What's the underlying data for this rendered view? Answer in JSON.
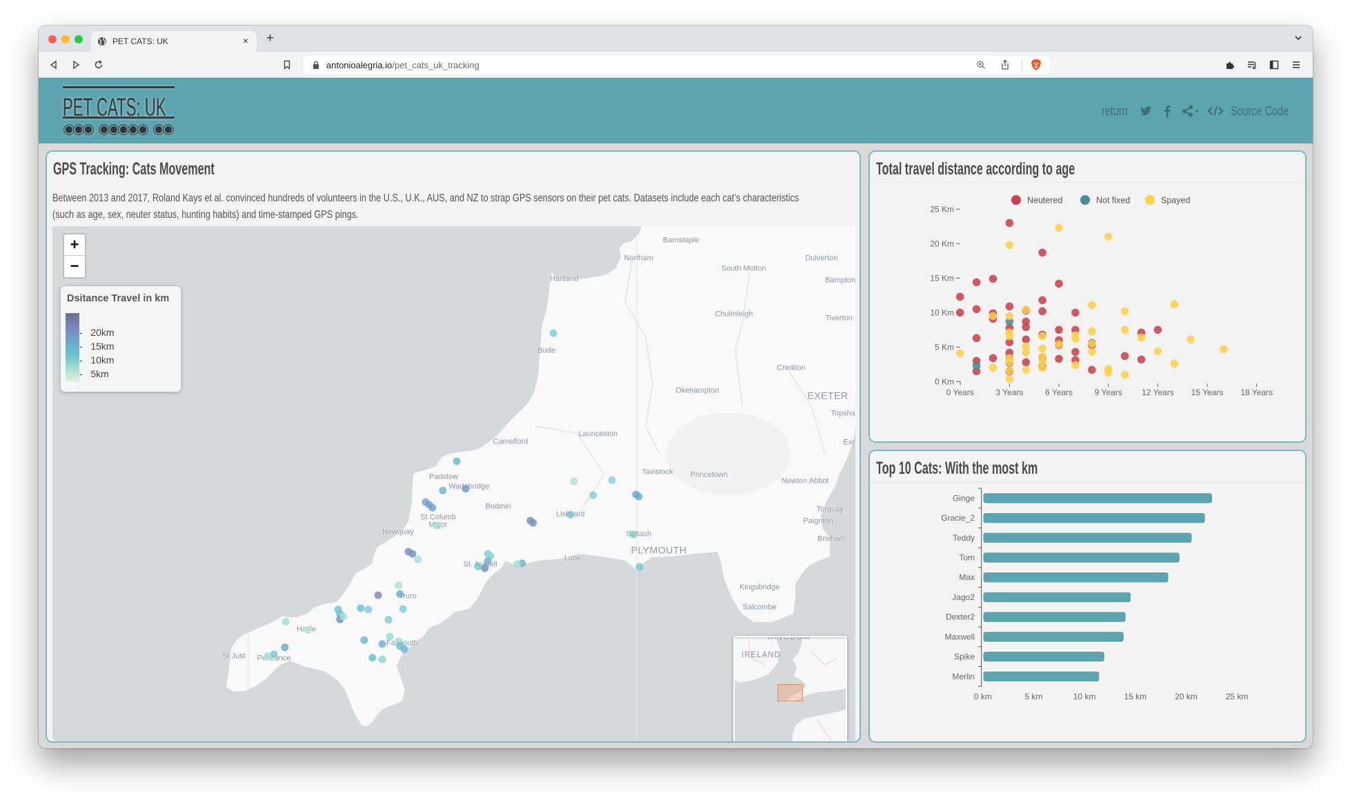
{
  "browser": {
    "tab_title": "PET CATS: UK",
    "new_tab_label": "+",
    "close_tab_label": "×",
    "url_domain": "antonioalegria.io",
    "url_path": "/pet_cats_uk_tracking",
    "icons": [
      "globe-icon",
      "back-icon",
      "forward-icon",
      "reload-icon",
      "bookmark-icon",
      "lock-icon",
      "zoom-icon",
      "share-icon",
      "brave-shield-icon",
      "extensions-icon",
      "playlist-icon",
      "sidebar-icon",
      "menu-icon",
      "chevron-down-icon"
    ]
  },
  "header": {
    "logo": "PET CATS: UK",
    "nav": {
      "return_label": "return",
      "source_code_label": "Source Code",
      "icons": [
        "twitter-icon",
        "facebook-icon",
        "share-icon",
        "caret-down-icon",
        "code-icon"
      ]
    },
    "brand_color": "#5ba4b0",
    "nav_color": "#3e6f77"
  },
  "map_card": {
    "title": "GPS Tracking: Cats Movement",
    "description_lines": [
      "Between 2013 and 2017, Roland Kays et al. convinced hundreds of volunteers in the U.S., U.K., AUS, and NZ to strap GPS sensors on their pet cats. Datasets include each cat’s characteristics",
      "(such as age, sex, neuter status, hunting habits) and time-stamped GPS pings."
    ],
    "zoom_in_label": "+",
    "zoom_out_label": "−",
    "legend": {
      "title": "Dsitance Travel in km",
      "ticks": [
        {
          "label": "20km",
          "km": 20
        },
        {
          "label": "15km",
          "km": 15
        },
        {
          "label": "10km",
          "km": 10
        },
        {
          "label": "5km",
          "km": 5
        }
      ],
      "color_stops": [
        {
          "km": 0,
          "color": "#e2f4d6"
        },
        {
          "km": 5,
          "color": "#a5ddd5"
        },
        {
          "km": 10,
          "color": "#67c3d0"
        },
        {
          "km": 15,
          "color": "#6ea4cc"
        },
        {
          "km": 20,
          "color": "#7a86c0"
        },
        {
          "km": 25,
          "color": "#6a7090"
        }
      ]
    },
    "places": [
      {
        "name": "Barnstaple",
        "lon": -4.068,
        "lat": 51.082
      },
      {
        "name": "Northam",
        "lon": -4.223,
        "lat": 51.04
      },
      {
        "name": "South Molton",
        "lon": -3.838,
        "lat": 51.016
      },
      {
        "name": "Dulverton",
        "lon": -3.553,
        "lat": 51.04
      },
      {
        "name": "Hartland",
        "lon": -4.496,
        "lat": 50.992
      },
      {
        "name": "Bampton",
        "lon": -3.484,
        "lat": 50.989
      },
      {
        "name": "Chulmleigh",
        "lon": -3.874,
        "lat": 50.91
      },
      {
        "name": "Tiverton",
        "lon": -3.489,
        "lat": 50.901
      },
      {
        "name": "Bude",
        "lon": -4.561,
        "lat": 50.826
      },
      {
        "name": "Crediton",
        "lon": -3.664,
        "lat": 50.786
      },
      {
        "name": "Okehampton",
        "lon": -4.008,
        "lat": 50.733
      },
      {
        "name": "EXETER",
        "lon": -3.53,
        "lat": 50.722,
        "type": "city"
      },
      {
        "name": "Topsha",
        "lon": -3.474,
        "lat": 50.68
      },
      {
        "name": "Exr",
        "lon": -3.452,
        "lat": 50.613
      },
      {
        "name": "Camelford",
        "lon": -4.693,
        "lat": 50.614
      },
      {
        "name": "Launceston",
        "lon": -4.372,
        "lat": 50.632
      },
      {
        "name": "Tavistock",
        "lon": -4.154,
        "lat": 50.544
      },
      {
        "name": "Princetown",
        "lon": -3.965,
        "lat": 50.538
      },
      {
        "name": "Newton Abbot",
        "lon": -3.613,
        "lat": 50.523
      },
      {
        "name": "Padstow",
        "lon": -4.938,
        "lat": 50.533
      },
      {
        "name": "Wadebridge",
        "lon": -4.845,
        "lat": 50.51
      },
      {
        "name": "Bodmin",
        "lon": -4.738,
        "lat": 50.464
      },
      {
        "name": "Torquay",
        "lon": -3.522,
        "lat": 50.458
      },
      {
        "name": "St Columb\nMajor",
        "lon": -4.958,
        "lat": 50.43
      },
      {
        "name": "Liskeard",
        "lon": -4.473,
        "lat": 50.446
      },
      {
        "name": "Paignton",
        "lon": -3.565,
        "lat": 50.43
      },
      {
        "name": "Newquay",
        "lon": -5.105,
        "lat": 50.405
      },
      {
        "name": "Saltash",
        "lon": -4.223,
        "lat": 50.4
      },
      {
        "name": "Brixham",
        "lon": -3.517,
        "lat": 50.389
      },
      {
        "name": "PLYMOUTH",
        "lon": -4.149,
        "lat": 50.363,
        "type": "city"
      },
      {
        "name": "Looe",
        "lon": -4.465,
        "lat": 50.344
      },
      {
        "name": "St. Austell",
        "lon": -4.804,
        "lat": 50.33
      },
      {
        "name": "Kingsbridge",
        "lon": -3.78,
        "lat": 50.277
      },
      {
        "name": "Truro",
        "lon": -5.07,
        "lat": 50.256
      },
      {
        "name": "Salcombe",
        "lon": -3.78,
        "lat": 50.23
      },
      {
        "name": "Hayle",
        "lon": -5.441,
        "lat": 50.179
      },
      {
        "name": "Falmouth",
        "lon": -5.09,
        "lat": 50.147
      },
      {
        "name": "St Just",
        "lon": -5.707,
        "lat": 50.117
      },
      {
        "name": "Penzance",
        "lon": -5.56,
        "lat": 50.112
      }
    ],
    "tracks": [
      {
        "lon": -4.536,
        "lat": 50.867,
        "km": 8
      },
      {
        "lon": -4.89,
        "lat": 50.57,
        "km": 12
      },
      {
        "lon": -4.941,
        "lat": 50.502,
        "km": 12
      },
      {
        "lon": -4.857,
        "lat": 50.506,
        "km": 16
      },
      {
        "lon": -5.004,
        "lat": 50.475,
        "km": 15
      },
      {
        "lon": -4.991,
        "lat": 50.469,
        "km": 15
      },
      {
        "lon": -4.979,
        "lat": 50.462,
        "km": 15
      },
      {
        "lon": -4.963,
        "lat": 50.421,
        "km": 5
      },
      {
        "lon": -5.067,
        "lat": 50.36,
        "km": 19
      },
      {
        "lon": -5.052,
        "lat": 50.355,
        "km": 18
      },
      {
        "lon": -5.032,
        "lat": 50.342,
        "km": 5
      },
      {
        "lon": -4.776,
        "lat": 50.355,
        "km": 8
      },
      {
        "lon": -4.766,
        "lat": 50.35,
        "km": 7
      },
      {
        "lon": -4.776,
        "lat": 50.338,
        "km": 13
      },
      {
        "lon": -4.812,
        "lat": 50.326,
        "km": 9
      },
      {
        "lon": -4.787,
        "lat": 50.322,
        "km": 20
      },
      {
        "lon": -4.65,
        "lat": 50.333,
        "km": 12
      },
      {
        "lon": -4.668,
        "lat": 50.331,
        "km": 5
      },
      {
        "lon": -4.62,
        "lat": 50.432,
        "km": 19
      },
      {
        "lon": -4.61,
        "lat": 50.427,
        "km": 18
      },
      {
        "lon": -4.46,
        "lat": 50.523,
        "km": 4
      },
      {
        "lon": -4.39,
        "lat": 50.491,
        "km": 8
      },
      {
        "lon": -4.473,
        "lat": 50.446,
        "km": 9
      },
      {
        "lon": -4.321,
        "lat": 50.526,
        "km": 7
      },
      {
        "lon": -4.233,
        "lat": 50.493,
        "km": 14
      },
      {
        "lon": -4.223,
        "lat": 50.488,
        "km": 14
      },
      {
        "lon": -4.243,
        "lat": 50.4,
        "km": 8
      },
      {
        "lon": -4.22,
        "lat": 50.325,
        "km": 9
      },
      {
        "lon": -5.178,
        "lat": 50.259,
        "km": 20
      },
      {
        "lon": -5.098,
        "lat": 50.262,
        "km": 13
      },
      {
        "lon": -5.103,
        "lat": 50.282,
        "km": 4
      },
      {
        "lon": -5.242,
        "lat": 50.229,
        "km": 10
      },
      {
        "lon": -5.214,
        "lat": 50.226,
        "km": 8
      },
      {
        "lon": -5.087,
        "lat": 50.227,
        "km": 8
      },
      {
        "lon": -5.318,
        "lat": 50.216,
        "km": 11
      },
      {
        "lon": -5.318,
        "lat": 50.203,
        "km": 19
      },
      {
        "lon": -5.305,
        "lat": 50.21,
        "km": 5
      },
      {
        "lon": -5.325,
        "lat": 50.226,
        "km": 9
      },
      {
        "lon": -5.14,
        "lat": 50.202,
        "km": 8
      },
      {
        "lon": -5.135,
        "lat": 50.163,
        "km": 6
      },
      {
        "lon": -5.229,
        "lat": 50.155,
        "km": 12
      },
      {
        "lon": -5.163,
        "lat": 50.146,
        "km": 13
      },
      {
        "lon": -5.103,
        "lat": 50.152,
        "km": 5
      },
      {
        "lon": -5.098,
        "lat": 50.141,
        "km": 11
      },
      {
        "lon": -5.082,
        "lat": 50.134,
        "km": 12
      },
      {
        "lon": -5.199,
        "lat": 50.114,
        "km": 11
      },
      {
        "lon": -5.163,
        "lat": 50.11,
        "km": 7
      },
      {
        "lon": -5.517,
        "lat": 50.198,
        "km": 5
      },
      {
        "lon": -5.52,
        "lat": 50.138,
        "km": 14
      },
      {
        "lon": -5.56,
        "lat": 50.122,
        "km": 9
      },
      {
        "lon": -5.583,
        "lat": 50.118,
        "km": 5
      },
      {
        "lon": -5.434,
        "lat": 50.179,
        "km": 4
      }
    ],
    "minimap": {
      "labels": [
        "KINGDOM",
        "IRELAND"
      ],
      "viewport_color": "#f08a4b"
    }
  },
  "chart_data": [
    {
      "type": "scatter",
      "title": "Total travel distance according to age",
      "xlabel": "",
      "ylabel": "",
      "xlim": [
        0,
        18
      ],
      "ylim": [
        0,
        25
      ],
      "x_ticks": [
        {
          "value": 0,
          "label": "0 Years"
        },
        {
          "value": 3,
          "label": "3 Years"
        },
        {
          "value": 6,
          "label": "6 Years"
        },
        {
          "value": 9,
          "label": "9 Years"
        },
        {
          "value": 12,
          "label": "12 Years"
        },
        {
          "value": 15,
          "label": "15 Years"
        },
        {
          "value": 18,
          "label": "18 Years"
        }
      ],
      "y_ticks": [
        {
          "value": 0,
          "label": "0 Km"
        },
        {
          "value": 5,
          "label": "5 Km"
        },
        {
          "value": 10,
          "label": "10 Km"
        },
        {
          "value": 15,
          "label": "15 Km"
        },
        {
          "value": 20,
          "label": "20 Km"
        },
        {
          "value": 25,
          "label": "25 Km"
        }
      ],
      "grid": false,
      "legend_position": "top-center",
      "series": [
        {
          "name": "Neutered",
          "color": "#c9424e",
          "points": [
            [
              0,
              12.3
            ],
            [
              0,
              10.0
            ],
            [
              1,
              14.4
            ],
            [
              1,
              10.5
            ],
            [
              1,
              6.3
            ],
            [
              1,
              3.0
            ],
            [
              1,
              1.5
            ],
            [
              2,
              14.9
            ],
            [
              2,
              9.9
            ],
            [
              2,
              9.1
            ],
            [
              2,
              3.4
            ],
            [
              3,
              23.0
            ],
            [
              3,
              10.9
            ],
            [
              3,
              7.8
            ],
            [
              3,
              5.7
            ],
            [
              3,
              4.2
            ],
            [
              3,
              3.5
            ],
            [
              3,
              2.7
            ],
            [
              3,
              1.5
            ],
            [
              4,
              10.3
            ],
            [
              4,
              8.7
            ],
            [
              4,
              7.9
            ],
            [
              4,
              6.1
            ],
            [
              4,
              2.8
            ],
            [
              5,
              18.7
            ],
            [
              5,
              11.8
            ],
            [
              5,
              10.2
            ],
            [
              5,
              6.8
            ],
            [
              5,
              3.5
            ],
            [
              5,
              2.2
            ],
            [
              6,
              14.2
            ],
            [
              6,
              7.5
            ],
            [
              6,
              6.0
            ],
            [
              6,
              5.3
            ],
            [
              6,
              3.3
            ],
            [
              7,
              10.0
            ],
            [
              7,
              7.5
            ],
            [
              7,
              4.3
            ],
            [
              7,
              3.1
            ],
            [
              8,
              5.6
            ],
            [
              8,
              5.3
            ],
            [
              8,
              1.7
            ],
            [
              10,
              3.7
            ],
            [
              11,
              7.1
            ],
            [
              11,
              3.2
            ],
            [
              12,
              7.5
            ]
          ]
        },
        {
          "name": "Not fixed",
          "color": "#4b8a94",
          "points": [
            [
              1,
              2.3
            ],
            [
              3,
              8.7
            ]
          ]
        },
        {
          "name": "Spayed",
          "color": "#fdd14a",
          "points": [
            [
              0,
              4.1
            ],
            [
              2,
              9.5
            ],
            [
              2,
              2.0
            ],
            [
              3,
              19.8
            ],
            [
              3,
              9.5
            ],
            [
              3,
              7.1
            ],
            [
              3,
              6.6
            ],
            [
              3,
              3.4
            ],
            [
              3,
              2.8
            ],
            [
              3,
              1.6
            ],
            [
              3,
              0.4
            ],
            [
              4,
              10.4
            ],
            [
              4,
              5.1
            ],
            [
              4,
              4.2
            ],
            [
              4,
              1.7
            ],
            [
              5,
              6.6
            ],
            [
              5,
              4.8
            ],
            [
              5,
              3.6
            ],
            [
              5,
              2.8
            ],
            [
              5,
              2.0
            ],
            [
              6,
              22.3
            ],
            [
              6,
              5.4
            ],
            [
              7,
              6.7
            ],
            [
              7,
              6.2
            ],
            [
              7,
              2.4
            ],
            [
              8,
              11.1
            ],
            [
              8,
              7.3
            ],
            [
              8,
              5.5
            ],
            [
              8,
              4.3
            ],
            [
              9,
              21.0
            ],
            [
              9,
              1.8
            ],
            [
              9,
              1.3
            ],
            [
              10,
              10.2
            ],
            [
              10,
              7.5
            ],
            [
              10,
              1.0
            ],
            [
              11,
              6.4
            ],
            [
              12,
              4.4
            ],
            [
              13,
              11.2
            ],
            [
              13,
              2.6
            ],
            [
              14,
              6.1
            ],
            [
              16,
              4.7
            ]
          ]
        }
      ]
    },
    {
      "type": "bar",
      "orientation": "horizontal",
      "title": "Top 10 Cats: With the most km",
      "categories": [
        "Ginge",
        "Gracie_2",
        "Teddy",
        "Tom",
        "Max",
        "Jago2",
        "Dexter2",
        "Maxwell",
        "Spike",
        "Merlin"
      ],
      "values": [
        22.6,
        21.9,
        20.6,
        19.4,
        18.3,
        14.6,
        14.1,
        13.9,
        12.0,
        11.5
      ],
      "xlabel": "",
      "ylabel": "",
      "xlim": [
        0,
        25
      ],
      "x_ticks": [
        {
          "value": 0,
          "label": "0 km"
        },
        {
          "value": 5,
          "label": "5 km"
        },
        {
          "value": 10,
          "label": "10 km"
        },
        {
          "value": 15,
          "label": "15 km"
        },
        {
          "value": 20,
          "label": "20 km"
        },
        {
          "value": 25,
          "label": "25 km"
        }
      ],
      "bar_color": "#5ca5b0",
      "grid": false
    }
  ]
}
